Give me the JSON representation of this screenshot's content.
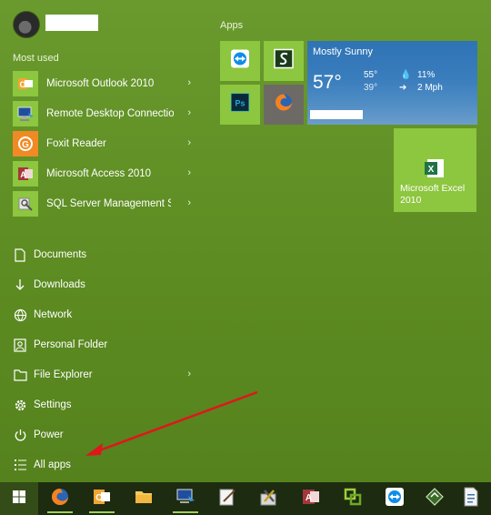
{
  "start_menu": {
    "most_used_label": "Most used",
    "apps_label": "Apps",
    "most_used": [
      {
        "label": "Microsoft Outlook 2010",
        "icon": "outlook-icon"
      },
      {
        "label": "Remote Desktop Connection",
        "icon": "remote-desktop-icon"
      },
      {
        "label": "Foxit Reader",
        "icon": "foxit-reader-icon"
      },
      {
        "label": "Microsoft Access 2010",
        "icon": "access-icon"
      },
      {
        "label": "SQL Server Management Studio",
        "icon": "sql-server-icon"
      }
    ],
    "system": [
      {
        "label": "Documents",
        "icon": "document-icon"
      },
      {
        "label": "Downloads",
        "icon": "download-icon"
      },
      {
        "label": "Network",
        "icon": "network-icon"
      },
      {
        "label": "Personal Folder",
        "icon": "person-folder-icon"
      },
      {
        "label": "File Explorer",
        "icon": "folder-icon"
      },
      {
        "label": "Settings",
        "icon": "gear-icon"
      },
      {
        "label": "Power",
        "icon": "power-icon"
      },
      {
        "label": "All apps",
        "icon": "list-icon"
      }
    ],
    "tiles": {
      "teamviewer": "teamviewer-icon",
      "sway": "sway-icon",
      "photoshop": "Ps",
      "firefox": "firefox-icon",
      "weather": {
        "condition": "Mostly Sunny",
        "temperature": "57°",
        "high": "55°",
        "low": "39°",
        "humidity": "11%",
        "wind": "2 Mph"
      },
      "excel": {
        "label": "Microsoft Excel 2010"
      }
    }
  },
  "taskbar": {
    "apps": [
      "firefox-icon",
      "outlook-icon",
      "file-explorer-icon",
      "remote-desktop-icon",
      "notepad-icon",
      "tools-icon",
      "access-icon",
      "vmware-icon",
      "teamviewer-icon",
      "sql-icon",
      "document-icon"
    ]
  },
  "colors": {
    "accent": "#8dc63f",
    "background": "#5e8f24",
    "taskbar": "#1d2b10",
    "arrow": "#e0161b"
  }
}
